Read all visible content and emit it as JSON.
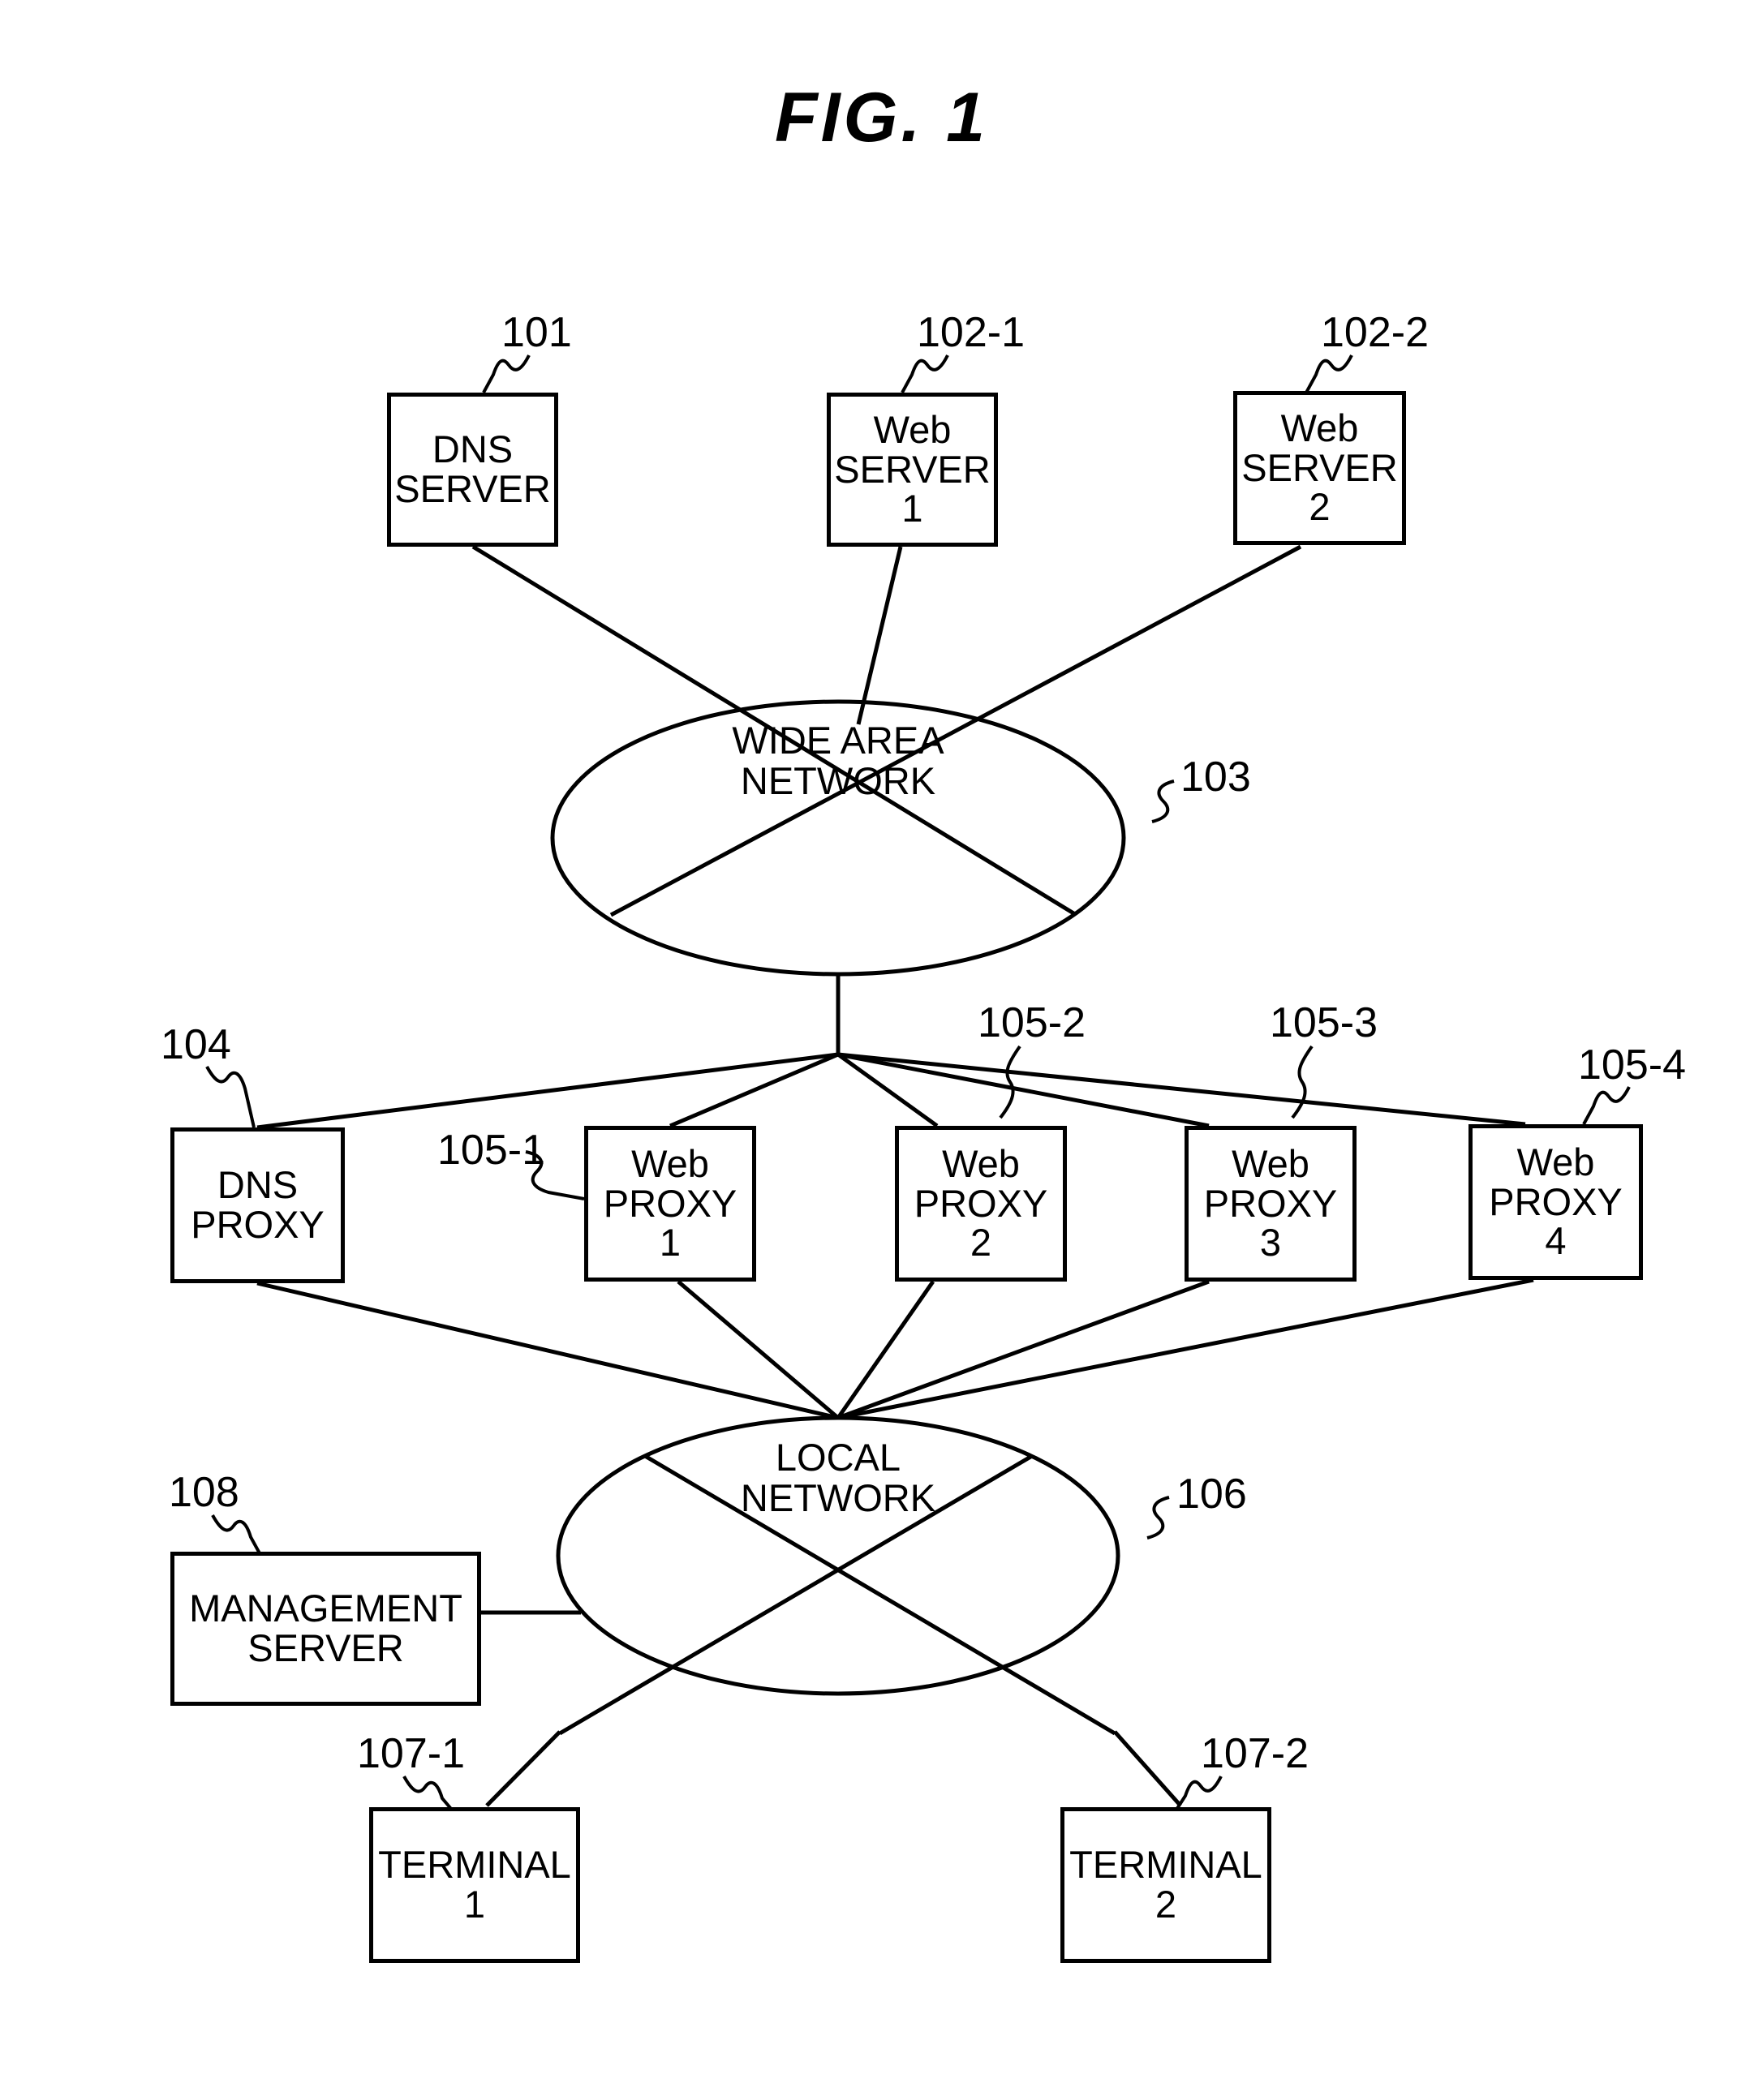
{
  "figure": {
    "title": "FIG.  1",
    "type": "network-architecture-block-diagram"
  },
  "nodes": {
    "dns_server": {
      "ref": "101",
      "lines": [
        "DNS",
        "SERVER"
      ]
    },
    "web_server_1": {
      "ref": "102-1",
      "lines": [
        "Web",
        "SERVER",
        "1"
      ]
    },
    "web_server_2": {
      "ref": "102-2",
      "lines": [
        "Web",
        "SERVER",
        "2"
      ]
    },
    "wide_area_network": {
      "ref": "103",
      "lines": [
        "WIDE AREA",
        "NETWORK"
      ]
    },
    "dns_proxy": {
      "ref": "104",
      "lines": [
        "DNS",
        "PROXY"
      ]
    },
    "web_proxy_1": {
      "ref": "105-1",
      "lines": [
        "Web",
        "PROXY",
        "1"
      ]
    },
    "web_proxy_2": {
      "ref": "105-2",
      "lines": [
        "Web",
        "PROXY",
        "2"
      ]
    },
    "web_proxy_3": {
      "ref": "105-3",
      "lines": [
        "Web",
        "PROXY",
        "3"
      ]
    },
    "web_proxy_4": {
      "ref": "105-4",
      "lines": [
        "Web",
        "PROXY",
        "4"
      ]
    },
    "local_network": {
      "ref": "106",
      "lines": [
        "LOCAL",
        "NETWORK"
      ]
    },
    "terminal_1": {
      "ref": "107-1",
      "lines": [
        "TERMINAL",
        "1"
      ]
    },
    "terminal_2": {
      "ref": "107-2",
      "lines": [
        "TERMINAL",
        "2"
      ]
    },
    "management_server": {
      "ref": "108",
      "lines": [
        "MANAGEMENT",
        "SERVER"
      ]
    }
  },
  "connections": [
    {
      "from": "dns_server",
      "to": "wide_area_network"
    },
    {
      "from": "web_server_1",
      "to": "wide_area_network"
    },
    {
      "from": "web_server_2",
      "to": "wide_area_network"
    },
    {
      "from": "wide_area_network",
      "to": "dns_proxy"
    },
    {
      "from": "wide_area_network",
      "to": "web_proxy_1"
    },
    {
      "from": "wide_area_network",
      "to": "web_proxy_2"
    },
    {
      "from": "wide_area_network",
      "to": "web_proxy_3"
    },
    {
      "from": "wide_area_network",
      "to": "web_proxy_4"
    },
    {
      "from": "dns_proxy",
      "to": "local_network"
    },
    {
      "from": "web_proxy_1",
      "to": "local_network"
    },
    {
      "from": "web_proxy_2",
      "to": "local_network"
    },
    {
      "from": "web_proxy_3",
      "to": "local_network"
    },
    {
      "from": "web_proxy_4",
      "to": "local_network"
    },
    {
      "from": "management_server",
      "to": "local_network"
    },
    {
      "from": "local_network",
      "to": "terminal_1"
    },
    {
      "from": "local_network",
      "to": "terminal_2"
    }
  ],
  "style": {
    "ink": "#000000",
    "paper": "#ffffff"
  }
}
